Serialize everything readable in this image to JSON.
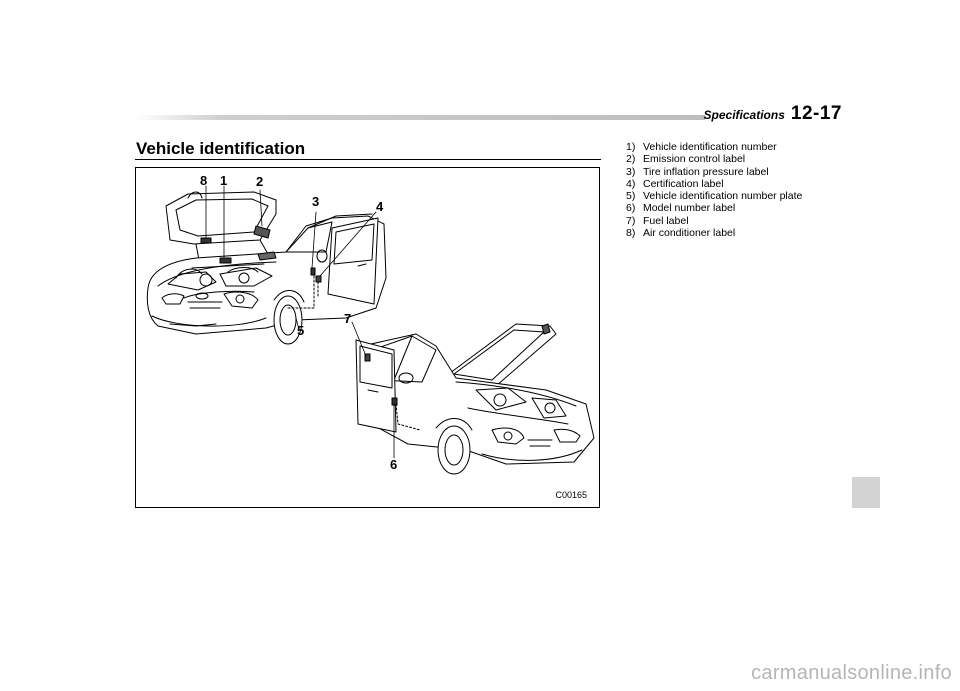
{
  "header": {
    "section": "Specifications",
    "page_number": "12-17"
  },
  "section_title": "Vehicle identification",
  "figure": {
    "code": "C00165",
    "callouts": [
      "8",
      "1",
      "2",
      "3",
      "4",
      "5",
      "7",
      "6"
    ]
  },
  "legend": [
    {
      "num": "1)",
      "text": "Vehicle identification number"
    },
    {
      "num": "2)",
      "text": "Emission control label"
    },
    {
      "num": "3)",
      "text": "Tire inflation pressure label"
    },
    {
      "num": "4)",
      "text": "Certification label"
    },
    {
      "num": "5)",
      "text": "Vehicle identification number plate"
    },
    {
      "num": "6)",
      "text": "Model number label"
    },
    {
      "num": "7)",
      "text": "Fuel label"
    },
    {
      "num": "8)",
      "text": "Air conditioner label"
    }
  ],
  "watermark": "carmanualsonline.info"
}
